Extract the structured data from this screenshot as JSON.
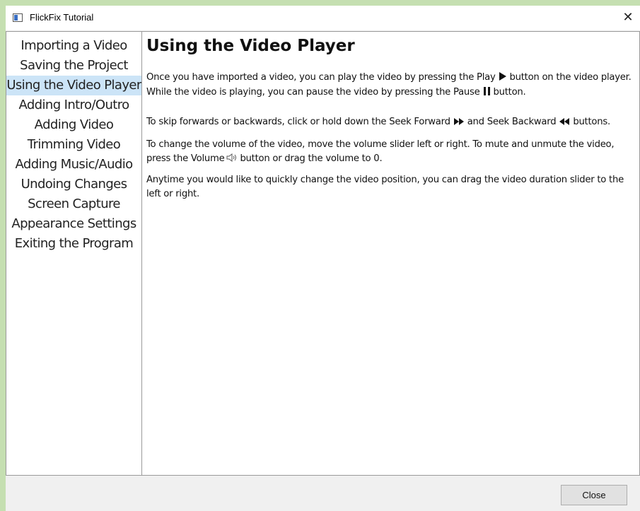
{
  "window": {
    "title": "FlickFix Tutorial",
    "close_glyph": "✕"
  },
  "nav": {
    "selected_index": 2,
    "items": [
      {
        "label": "Importing a Video"
      },
      {
        "label": "Saving the Project"
      },
      {
        "label": "Using the Video Player"
      },
      {
        "label": "Adding Intro/Outro"
      },
      {
        "label": "Adding Video"
      },
      {
        "label": "Trimming Video"
      },
      {
        "label": "Adding Music/Audio"
      },
      {
        "label": "Undoing Changes"
      },
      {
        "label": "Screen Capture"
      },
      {
        "label": "Appearance Settings"
      },
      {
        "label": "Exiting the Program"
      }
    ]
  },
  "content": {
    "heading": "Using the Video Player",
    "p1": {
      "a": "Once you have imported a video, you can play the video by pressing the Play",
      "b": "button on the video player. While the video is playing, you can pause the video by pressing the Pause",
      "c": "button."
    },
    "p2": {
      "a": "To skip forwards or backwards, click or hold down the Seek Forward",
      "b": "and Seek Backward",
      "c": "buttons."
    },
    "p3": {
      "a": "To change the volume of the video, move the volume slider left or right. To mute and unmute the video, press the Volume",
      "b": "button or drag the volume to 0."
    },
    "p4": "Anytime you would like to quickly change the video position, you can drag the video duration slider to the left or right.",
    "icons": [
      "play-icon",
      "pause-icon",
      "seek-forward-icon",
      "seek-backward-icon",
      "volume-icon"
    ]
  },
  "footer": {
    "close_label": "Close"
  },
  "colors": {
    "selected_bg": "#cce4f7",
    "page_bg": "#c5dfb1",
    "pane_bg": "#ffffff",
    "frame_bg": "#f0f0f0"
  }
}
